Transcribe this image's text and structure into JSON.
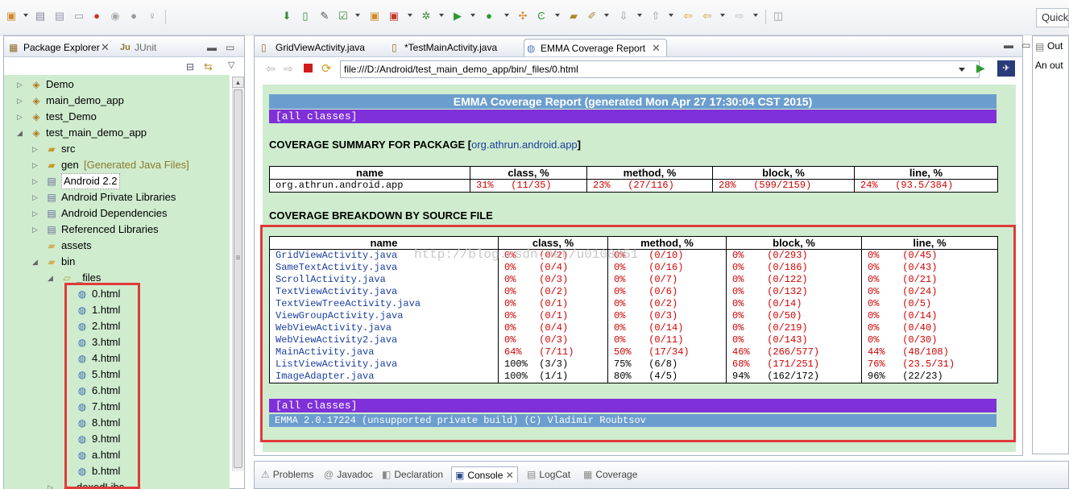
{
  "toolbar": {
    "quick_access": "Quick"
  },
  "package_explorer": {
    "tab_label": "Package Explorer",
    "junit_tab_label": "JUnit",
    "tree": [
      {
        "label": "Demo",
        "icon": "project-icon",
        "level": 0,
        "twisty": "collapsed"
      },
      {
        "label": "main_demo_app",
        "icon": "project-icon",
        "level": 0,
        "twisty": "collapsed"
      },
      {
        "label": "test_Demo",
        "icon": "project-icon",
        "level": 0,
        "twisty": "collapsed"
      },
      {
        "label": "test_main_demo_app",
        "icon": "project-icon",
        "level": 0,
        "twisty": "expanded"
      },
      {
        "label": "src",
        "icon": "source-folder-icon",
        "level": 1,
        "twisty": "collapsed"
      },
      {
        "label": "gen",
        "suffix": "[Generated Java Files]",
        "icon": "source-folder-icon",
        "level": 1,
        "twisty": "collapsed"
      },
      {
        "label": "Android 2.2",
        "icon": "library-icon",
        "level": 1,
        "twisty": "collapsed",
        "selected": true
      },
      {
        "label": "Android Private Libraries",
        "icon": "library-icon",
        "level": 1,
        "twisty": "collapsed"
      },
      {
        "label": "Android Dependencies",
        "icon": "library-icon",
        "level": 1,
        "twisty": "collapsed"
      },
      {
        "label": "Referenced Libraries",
        "icon": "library-icon",
        "level": 1,
        "twisty": "collapsed"
      },
      {
        "label": "assets",
        "icon": "folder-icon",
        "level": 1,
        "twisty": "none"
      },
      {
        "label": "bin",
        "icon": "folder-icon",
        "level": 1,
        "twisty": "expanded"
      },
      {
        "label": "_files",
        "icon": "open-folder-icon",
        "level": 2,
        "twisty": "expanded"
      },
      {
        "label": "0.html",
        "icon": "html-file-icon",
        "level": 3,
        "twisty": "none"
      },
      {
        "label": "1.html",
        "icon": "html-file-icon",
        "level": 3,
        "twisty": "none"
      },
      {
        "label": "2.html",
        "icon": "html-file-icon",
        "level": 3,
        "twisty": "none"
      },
      {
        "label": "3.html",
        "icon": "html-file-icon",
        "level": 3,
        "twisty": "none"
      },
      {
        "label": "4.html",
        "icon": "html-file-icon",
        "level": 3,
        "twisty": "none"
      },
      {
        "label": "5.html",
        "icon": "html-file-icon",
        "level": 3,
        "twisty": "none"
      },
      {
        "label": "6.html",
        "icon": "html-file-icon",
        "level": 3,
        "twisty": "none"
      },
      {
        "label": "7.html",
        "icon": "html-file-icon",
        "level": 3,
        "twisty": "none"
      },
      {
        "label": "8.html",
        "icon": "html-file-icon",
        "level": 3,
        "twisty": "none"
      },
      {
        "label": "9.html",
        "icon": "html-file-icon",
        "level": 3,
        "twisty": "none"
      },
      {
        "label": "a.html",
        "icon": "html-file-icon",
        "level": 3,
        "twisty": "none"
      },
      {
        "label": "b.html",
        "icon": "html-file-icon",
        "level": 3,
        "twisty": "none"
      },
      {
        "label": "dexedLibs",
        "icon": "folder-icon",
        "level": 2,
        "twisty": "collapsed"
      }
    ]
  },
  "editor": {
    "tabs": [
      {
        "label": "GridViewActivity.java",
        "icon": "java-file-icon"
      },
      {
        "label": "*TestMainActivity.java",
        "icon": "java-file-icon"
      },
      {
        "label": "EMMA Coverage Report",
        "icon": "globe-icon",
        "active": true
      }
    ],
    "url": "file:///D:/Android/test_main_demo_app/bin/_files/0.html"
  },
  "report": {
    "title": "EMMA Coverage Report (generated Mon Apr 27 17:30:04 CST 2015)",
    "all_classes": "[all classes]",
    "summary_heading": "COVERAGE SUMMARY FOR PACKAGE [",
    "summary_heading_end": "]",
    "package_link": "org.athrun.android.app",
    "columns": [
      "name",
      "class, %",
      "method, %",
      "block, %",
      "line, %"
    ],
    "summary_row": {
      "name": "org.athrun.android.app",
      "class": "31%   (11/35)",
      "method": "23%   (27/116)",
      "block": "28%   (599/2159)",
      "line": "24%   (93.5/384)"
    },
    "breakdown_heading": "COVERAGE BREAKDOWN BY SOURCE FILE",
    "files": [
      {
        "name": "GridViewActivity.java",
        "class": "0%    (0/2)",
        "method": "0%    (0/10)",
        "block": "0%    (0/293)",
        "line": "0%    (0/45)",
        "colors": [
          "red",
          "red",
          "red",
          "red"
        ]
      },
      {
        "name": "SameTextActivity.java",
        "class": "0%    (0/4)",
        "method": "0%    (0/16)",
        "block": "0%    (0/186)",
        "line": "0%    (0/43)",
        "colors": [
          "red",
          "red",
          "red",
          "red"
        ]
      },
      {
        "name": "ScrollActivity.java",
        "class": "0%    (0/3)",
        "method": "0%    (0/7)",
        "block": "0%    (0/122)",
        "line": "0%    (0/21)",
        "colors": [
          "red",
          "red",
          "red",
          "red"
        ]
      },
      {
        "name": "TextViewActivity.java",
        "class": "0%    (0/2)",
        "method": "0%    (0/6)",
        "block": "0%    (0/132)",
        "line": "0%    (0/24)",
        "colors": [
          "red",
          "red",
          "red",
          "red"
        ]
      },
      {
        "name": "TextViewTreeActivity.java",
        "class": "0%    (0/1)",
        "method": "0%    (0/2)",
        "block": "0%    (0/14)",
        "line": "0%    (0/5)",
        "colors": [
          "red",
          "red",
          "red",
          "red"
        ]
      },
      {
        "name": "ViewGroupActivity.java",
        "class": "0%    (0/1)",
        "method": "0%    (0/3)",
        "block": "0%    (0/50)",
        "line": "0%    (0/14)",
        "colors": [
          "red",
          "red",
          "red",
          "red"
        ]
      },
      {
        "name": "WebViewActivity.java",
        "class": "0%    (0/4)",
        "method": "0%    (0/14)",
        "block": "0%    (0/219)",
        "line": "0%    (0/40)",
        "colors": [
          "red",
          "red",
          "red",
          "red"
        ]
      },
      {
        "name": "WebViewActivity2.java",
        "class": "0%    (0/3)",
        "method": "0%    (0/11)",
        "block": "0%    (0/143)",
        "line": "0%    (0/30)",
        "colors": [
          "red",
          "red",
          "red",
          "red"
        ]
      },
      {
        "name": "MainActivity.java",
        "class": "64%   (7/11)",
        "method": "50%   (17/34)",
        "block": "46%   (266/577)",
        "line": "44%   (48/108)",
        "colors": [
          "red",
          "red",
          "red",
          "red"
        ]
      },
      {
        "name": "ListViewActivity.java",
        "class": "100%  (3/3)",
        "method": "75%   (6/8)",
        "block": "68%   (171/251)",
        "line": "76%   (23.5/31)",
        "colors": [
          "black",
          "black",
          "red",
          "red"
        ]
      },
      {
        "name": "ImageAdapter.java",
        "class": "100%  (1/1)",
        "method": "80%   (4/5)",
        "block": "94%   (162/172)",
        "line": "96%   (22/23)",
        "colors": [
          "black",
          "black",
          "black",
          "black"
        ]
      }
    ],
    "footer": "EMMA 2.0.17224 (unsupported private build) (C) Vladimir Roubtsov",
    "watermark": "http://blog.csdn.net/u0108051"
  },
  "bottom_panel": {
    "tabs": [
      {
        "label": "Problems",
        "icon": "problems-icon"
      },
      {
        "label": "Javadoc",
        "icon": "javadoc-icon"
      },
      {
        "label": "Declaration",
        "icon": "declaration-icon"
      },
      {
        "label": "Console",
        "icon": "console-icon",
        "active": true
      },
      {
        "label": "LogCat",
        "icon": "logcat-icon"
      },
      {
        "label": "Coverage",
        "icon": "coverage-icon"
      }
    ]
  },
  "outline": {
    "tab_label": "Out",
    "text": "An out"
  },
  "colors": {
    "report_header": "#6b9ece",
    "report_bar": "#7f30d8",
    "page_background": "#cfeccf",
    "highlight": "#e03a3a",
    "red_text": "#d10000",
    "link": "#1a3e9e"
  }
}
